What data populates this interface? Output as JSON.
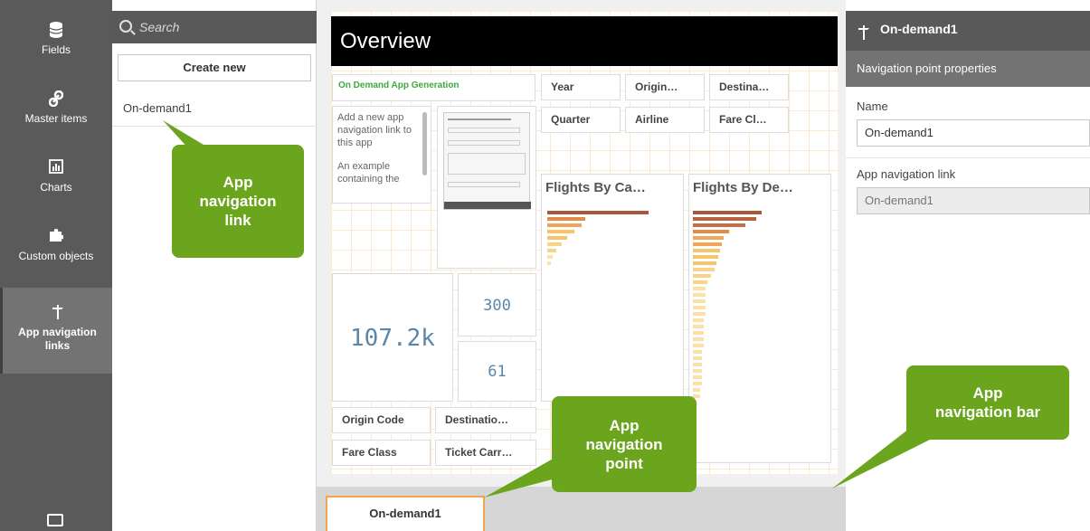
{
  "sidebar": {
    "items": [
      {
        "label": "Fields",
        "icon": "database-icon"
      },
      {
        "label": "Master items",
        "icon": "link-icon"
      },
      {
        "label": "Charts",
        "icon": "bar-chart-icon"
      },
      {
        "label": "Custom objects",
        "icon": "puzzle-icon"
      },
      {
        "label": "App navigation links",
        "icon": "signpost-icon"
      }
    ]
  },
  "assets": {
    "search_placeholder": "Search",
    "create_new": "Create new",
    "list": [
      "On-demand1"
    ]
  },
  "sheet": {
    "title": "Overview",
    "app_gen_title": "On Demand App Generation",
    "app_gen_text_1": "Add a new app navigation link to this app",
    "app_gen_text_2": "An example containing the",
    "filters_top": [
      "Year",
      "Origin…",
      "Destina…",
      "Quarter",
      "Airline",
      "Fare Cl…"
    ],
    "filters_bottom": [
      "Origin Code",
      "Destinatio…",
      "Fare Class",
      "Ticket Carr…"
    ],
    "kpi_main": "107.2k",
    "kpi_a": "300",
    "kpi_b": "61",
    "chart1_title": "Flights By Ca…",
    "chart2_title": "Flights By De…"
  },
  "navbar": {
    "tab_label": "On-demand1"
  },
  "props": {
    "header_title": "On-demand1",
    "section_title": "Navigation point properties",
    "name_label": "Name",
    "name_value": "On-demand1",
    "link_label": "App navigation link",
    "link_value": "On-demand1"
  },
  "callouts": {
    "nav_link": [
      "App",
      "navigation",
      "link"
    ],
    "nav_point": [
      "App",
      "navigation",
      "point"
    ],
    "nav_bar": [
      "App",
      "navigation bar"
    ]
  },
  "colors": {
    "callout_green": "#6aa51d",
    "bar_dark": "#a9563a",
    "bar_mid": "#e08a4b",
    "bar_light": "#f7c46a",
    "kpi_blue": "#5b86a8"
  }
}
